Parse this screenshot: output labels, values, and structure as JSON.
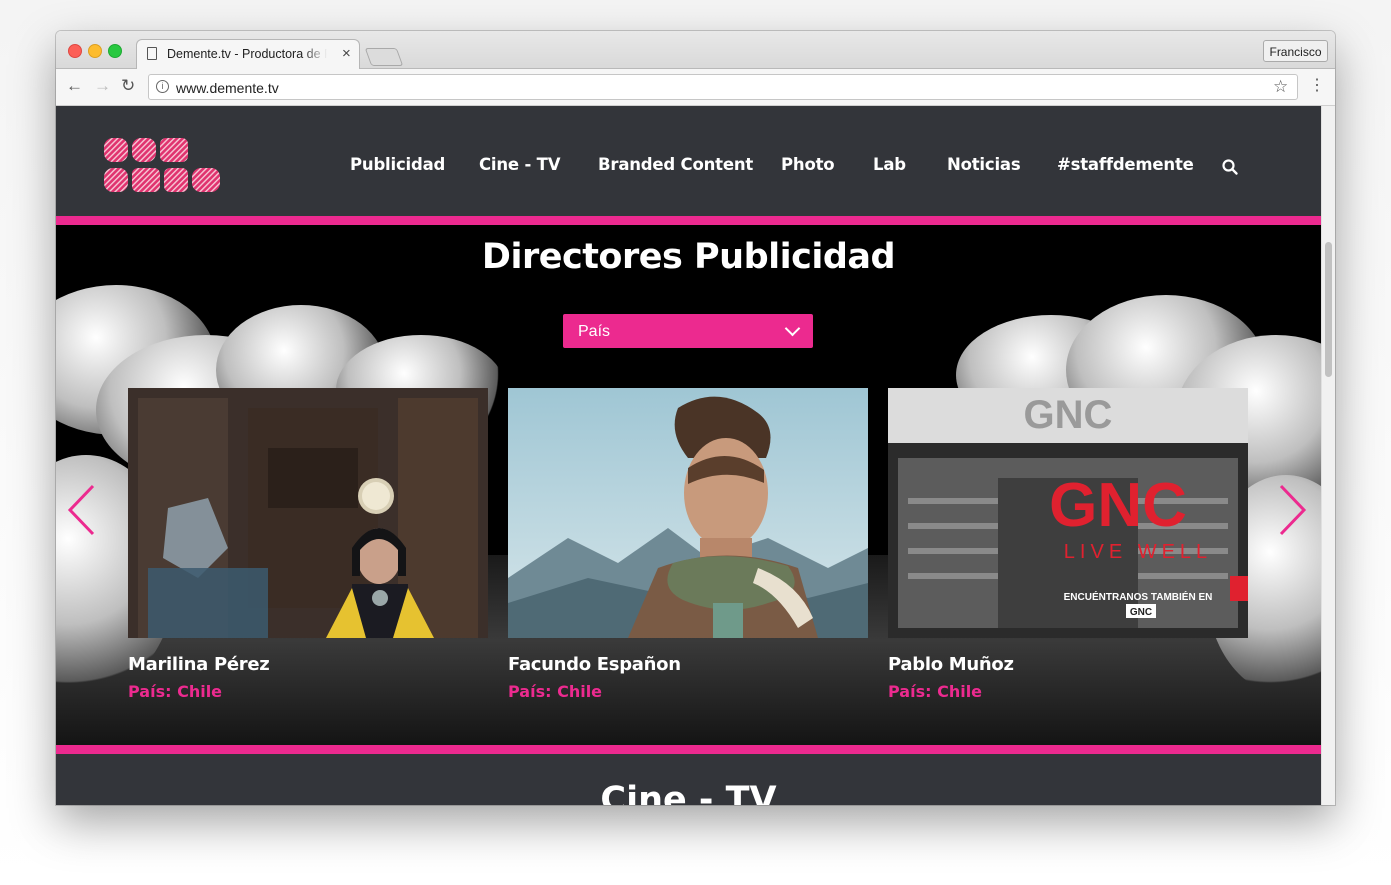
{
  "browser": {
    "tab_title": "Demente.tv - Productora de Publicidad",
    "tab_close": "×",
    "profile_name": "Francisco",
    "url": "www.demente.tv",
    "back_glyph": "←",
    "forward_glyph": "→",
    "reload_glyph": "↻",
    "star_glyph": "☆",
    "menu_glyph": "⋮",
    "info_glyph": "i"
  },
  "site": {
    "logo_name": "logo-icon",
    "nav": [
      {
        "label": "Publicidad"
      },
      {
        "label": "Cine - TV"
      },
      {
        "label": "Branded Content"
      },
      {
        "label": "Photo"
      },
      {
        "label": "Lab"
      },
      {
        "label": "Noticias"
      },
      {
        "label": "#staffdemente"
      }
    ],
    "accent_color": "#ec2a8f",
    "header_color": "#33353a",
    "hero": {
      "title": "Directores Publicidad",
      "filter_value": "País",
      "directors": [
        {
          "name": "Marilina Pérez",
          "country": "País: Chile"
        },
        {
          "name": "Facundo Españon",
          "country": "País: Chile"
        },
        {
          "name": "Pablo Muñoz",
          "country": "País: Chile"
        }
      ],
      "ad_text": {
        "gnc_sign": "GNC",
        "gnc_live_well": "LIVE WELL",
        "gnc_tagline": "ENCUÉNTRANOS TAMBIÉN EN",
        "gnc_small": "GNC"
      }
    },
    "next_section_title": "Cine - TV"
  }
}
